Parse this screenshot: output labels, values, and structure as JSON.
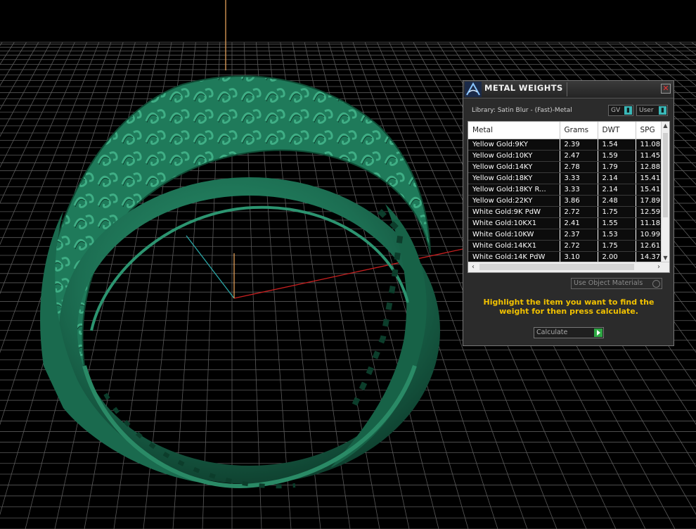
{
  "panel": {
    "title": "METAL WEIGHTS",
    "close_icon": "close-icon",
    "library_label": "Library: Satin Blur - (Fast)-Metal",
    "gv_dropdown": "GV",
    "user_dropdown": "User",
    "table": {
      "headers": [
        "Metal",
        "Grams",
        "DWT",
        "SPG"
      ],
      "rows": [
        [
          "Yellow Gold:9KY",
          "2.39",
          "1.54",
          "11.08"
        ],
        [
          "Yellow Gold:10KY",
          "2.47",
          "1.59",
          "11.45"
        ],
        [
          "Yellow Gold:14KY",
          "2.78",
          "1.79",
          "12.88"
        ],
        [
          "Yellow Gold:18KY",
          "3.33",
          "2.14",
          "15.41"
        ],
        [
          "Yellow Gold:18KY R...",
          "3.33",
          "2.14",
          "15.41"
        ],
        [
          "Yellow Gold:22KY",
          "3.86",
          "2.48",
          "17.89"
        ],
        [
          "White Gold:9K PdW",
          "2.72",
          "1.75",
          "12.59"
        ],
        [
          "White Gold:10KX1",
          "2.41",
          "1.55",
          "11.18"
        ],
        [
          "White Gold:10KW",
          "2.37",
          "1.53",
          "10.99"
        ],
        [
          "White Gold:14KX1",
          "2.72",
          "1.75",
          "12.61"
        ],
        [
          "White Gold:14K PdW",
          "3.10",
          "2.00",
          "14.37"
        ]
      ]
    },
    "use_object_materials": "Use Object Materials",
    "hint": "Highlight the item you want to find the weight for then press calculate.",
    "calculate_label": "Calculate"
  },
  "colors": {
    "ring": "#1f7a5a",
    "grid": "#5a5a5a",
    "hint": "#f2c200",
    "accent": "#3bb8b8",
    "go": "#2ea844"
  }
}
